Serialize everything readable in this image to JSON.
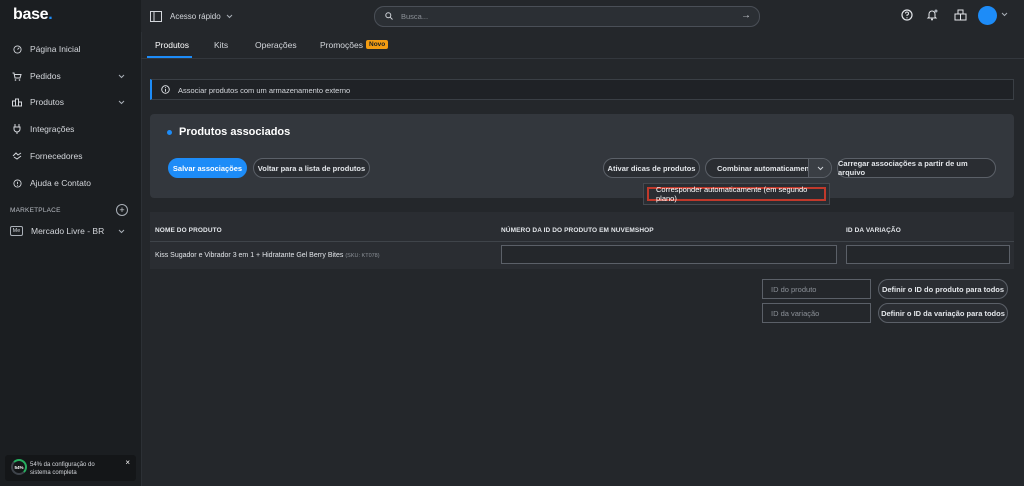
{
  "brand": {
    "logo_text": "base",
    "logo_dot": ".",
    "accent": "#1d8cf8"
  },
  "sidebar": {
    "items": [
      {
        "label": "Página Inicial",
        "icon": "dashboard-icon",
        "has_chevron": false
      },
      {
        "label": "Pedidos",
        "icon": "cart-icon",
        "has_chevron": true
      },
      {
        "label": "Produtos",
        "icon": "products-icon",
        "has_chevron": true
      },
      {
        "label": "Integrações",
        "icon": "plug-icon",
        "has_chevron": false
      },
      {
        "label": "Fornecedores",
        "icon": "handshake-icon",
        "has_chevron": false
      },
      {
        "label": "Ajuda e Contato",
        "icon": "help-icon",
        "has_chevron": false
      }
    ],
    "marketplace_label": "MARKETPLACE",
    "marketplace_item": {
      "badge": "Me",
      "label": "Mercado Livre - BR"
    },
    "setup": {
      "percent": "54%",
      "text": "54% da configuração do sistema completa",
      "close": "×"
    }
  },
  "topbar": {
    "quick_access": "Acesso rápido",
    "search_placeholder": "Busca...",
    "search_submit": "→"
  },
  "tabs": [
    {
      "label": "Produtos",
      "active": true
    },
    {
      "label": "Kits",
      "active": false
    },
    {
      "label": "Operações",
      "active": false
    },
    {
      "label": "Promoções",
      "active": false
    }
  ],
  "tab_badge": "Novo",
  "info_bar": {
    "text": "Associar produtos com um armazenamento externo"
  },
  "panel": {
    "title": "Produtos associados",
    "save_button": "Salvar associações",
    "back_button": "Voltar para a lista de produtos",
    "tips_button": "Ativar dicas de produtos",
    "auto_button": "Combinar automaticamente",
    "load_button": "Carregar associações a partir de um arquivo"
  },
  "dropdown": {
    "item": "Corresponder automaticamente (em segundo plano)"
  },
  "table": {
    "headers": [
      "NOME DO PRODUTO",
      "NÚMERO DA ID DO PRODUTO EM NUVEMSHOP",
      "ID DA VARIAÇÃO"
    ],
    "rows": [
      {
        "name": "Kiss Sugador e Vibrador 3 em 1 + Hidratante Gel Berry Bites",
        "sku": "(SKU: KT078)",
        "product_id": "",
        "variation_id": ""
      }
    ]
  },
  "bulk": {
    "product_id_placeholder": "ID do produto",
    "variation_id_placeholder": "ID da variação",
    "set_product_button": "Definir o ID do produto para todos",
    "set_variation_button": "Definir o ID da variação para todos"
  }
}
